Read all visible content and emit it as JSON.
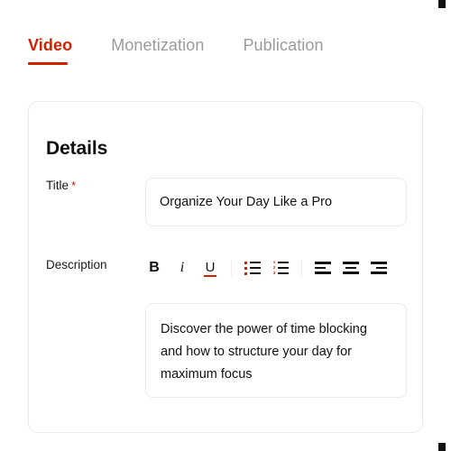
{
  "tabs": [
    {
      "label": "Video",
      "active": true
    },
    {
      "label": "Monetization",
      "active": false
    },
    {
      "label": "Publication",
      "active": false
    }
  ],
  "card": {
    "title": "Details",
    "title_field": {
      "label": "Title",
      "required_marker": "*",
      "value": "Organize Your Day Like a Pro"
    },
    "description_field": {
      "label": "Description",
      "value": "Discover the power of time blocking and how to structure your day for maximum focus"
    },
    "toolbar": {
      "bold": "B",
      "italic": "i",
      "underline": "U",
      "bullet_list": "bulleted-list-icon",
      "numbered_list": "numbered-list-icon",
      "numbers": [
        "1",
        "2",
        "3"
      ],
      "align_left": "align-left-icon",
      "align_center": "align-center-icon",
      "align_right": "align-right-icon"
    }
  },
  "colors": {
    "accent": "#cc2200",
    "text": "#111111",
    "muted": "#9b9b9b",
    "border": "#eaeaea"
  }
}
